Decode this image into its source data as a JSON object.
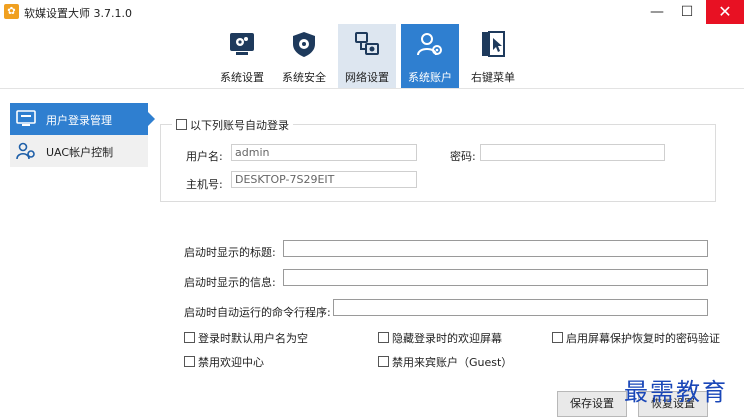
{
  "window": {
    "title": "软媒设置大师 3.7.1.0",
    "minimize": "—",
    "maximize": "☐",
    "close": "✕"
  },
  "toolbar": {
    "items": [
      {
        "label": "系统设置",
        "icon": "monitor-gear-icon"
      },
      {
        "label": "系统安全",
        "icon": "shield-gear-icon"
      },
      {
        "label": "网络设置",
        "icon": "network-icon"
      },
      {
        "label": "系统账户",
        "icon": "user-account-icon"
      },
      {
        "label": "右键菜单",
        "icon": "cursor-menu-icon"
      }
    ],
    "selected_index": 2,
    "active_index": 3
  },
  "sidebar": {
    "items": [
      {
        "label": "用户登录管理",
        "icon": "monitor-login-icon",
        "active": true
      },
      {
        "label": "UAC帐户控制",
        "icon": "users-icon",
        "active": false
      }
    ]
  },
  "autologin": {
    "checkbox_label": "以下列账号自动登录",
    "username_label": "用户名:",
    "username_value": "admin",
    "password_label": "密码:",
    "password_value": "",
    "hostname_label": "主机号:",
    "hostname_value": "DESKTOP-7S29EIT"
  },
  "startup": {
    "title_label": "启动时显示的标题:",
    "title_value": "",
    "message_label": "启动时显示的信息:",
    "message_value": "",
    "command_label": "启动时自动运行的命令行程序:",
    "command_value": ""
  },
  "options": {
    "default_empty_user": "登录时默认用户名为空",
    "hide_welcome": "隐藏登录时的欢迎屏幕",
    "screensaver_password": "启用屏幕保护恢复时的密码验证",
    "disable_welcome_center": "禁用欢迎中心",
    "disable_guest": "禁用来宾账户（Guest）"
  },
  "buttons": {
    "save": "保存设置",
    "restore": "恢复设置"
  },
  "watermark": "最需教育"
}
